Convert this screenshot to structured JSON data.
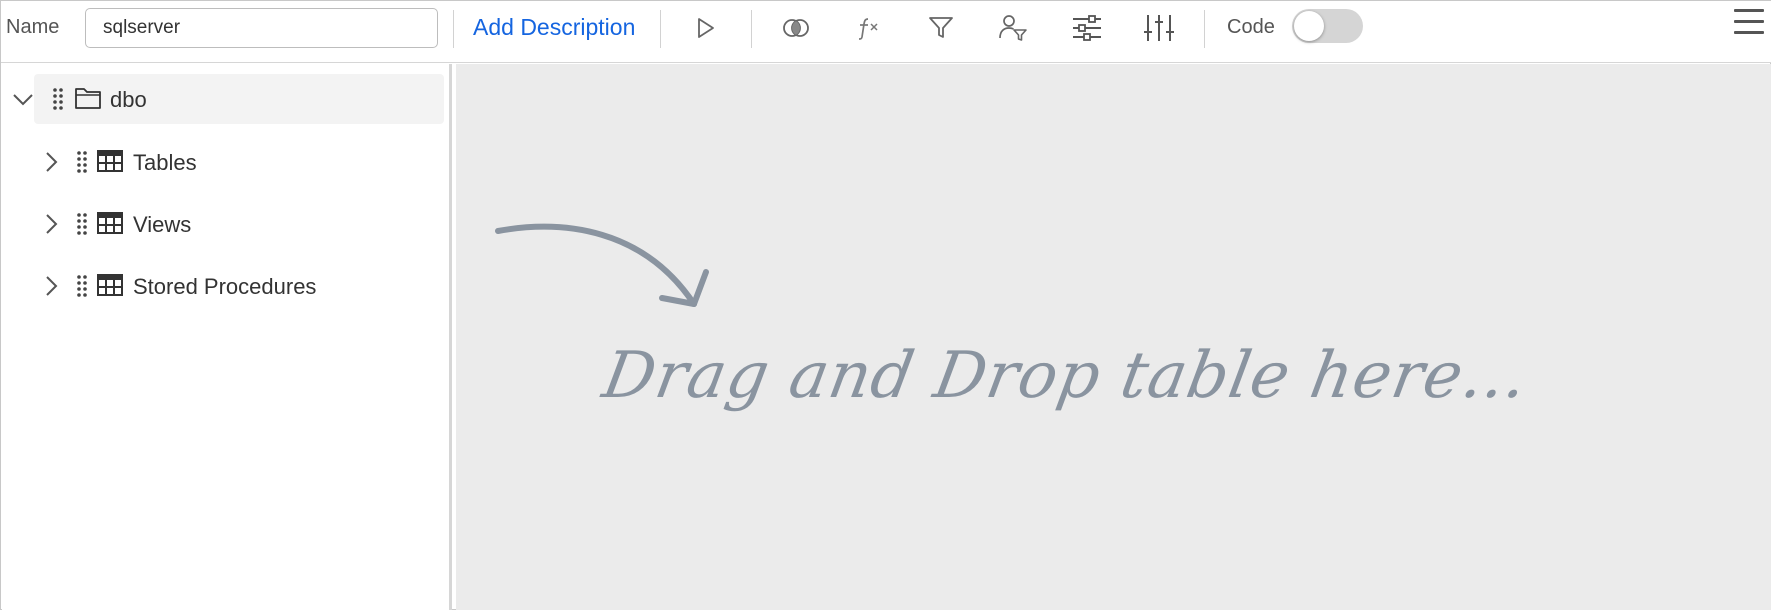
{
  "toolbar": {
    "name_label": "Name",
    "name_value": "sqlserver",
    "add_description": "Add Description",
    "code_label": "Code",
    "code_enabled": false,
    "icons": [
      "run-icon",
      "join-icon",
      "function-icon",
      "filter-icon",
      "user-filter-icon",
      "settings-icon",
      "sort-icon",
      "menu-icon"
    ]
  },
  "tree": {
    "root": {
      "label": "dbo",
      "expanded": true,
      "icon": "folder-icon"
    },
    "children": [
      {
        "label": "Tables",
        "expanded": false,
        "icon": "table-icon"
      },
      {
        "label": "Views",
        "expanded": false,
        "icon": "table-icon"
      },
      {
        "label": "Stored Procedures",
        "expanded": false,
        "icon": "table-icon"
      }
    ]
  },
  "canvas": {
    "hint": "Drag and Drop table here...",
    "colors": {
      "hint": "#8a94a0",
      "background": "#ebebeb",
      "accent": "#1565e0"
    }
  }
}
